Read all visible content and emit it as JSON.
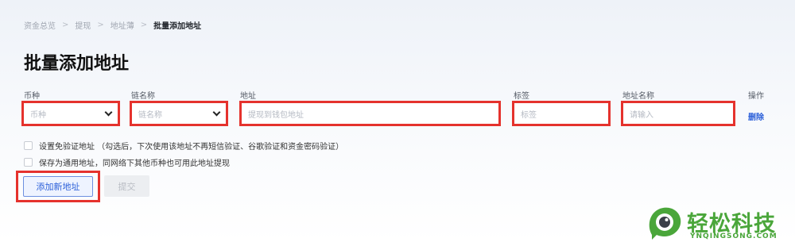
{
  "breadcrumb": {
    "items": [
      "资金总览",
      "提现",
      "地址薄"
    ],
    "current": "批量添加地址",
    "separator": ">"
  },
  "page": {
    "title": "批量添加地址"
  },
  "columns": {
    "coin": "币种",
    "chain": "链名称",
    "address": "地址",
    "tag": "标签",
    "name": "地址名称",
    "ops": "操作"
  },
  "row": {
    "coin_placeholder": "币种",
    "chain_placeholder": "链名称",
    "address_placeholder": "提现到钱包地址",
    "tag_placeholder": "标签",
    "name_placeholder": "请输入",
    "delete_label": "删除"
  },
  "options": {
    "exempt_verify": "设置免验证地址 （勾选后，下次使用该地址不再短信验证、谷歌验证和资金密码验证）",
    "universal": "保存为通用地址，同网络下其他币种也可用此地址提现"
  },
  "buttons": {
    "add_new": "添加新地址",
    "submit": "提交"
  },
  "watermark": {
    "brand": "轻松科技",
    "url": "YNQINGSONG.COM"
  },
  "colors": {
    "highlight": "#e5322d",
    "link": "#2b5fd9",
    "brand_green": "#4aa63a"
  }
}
